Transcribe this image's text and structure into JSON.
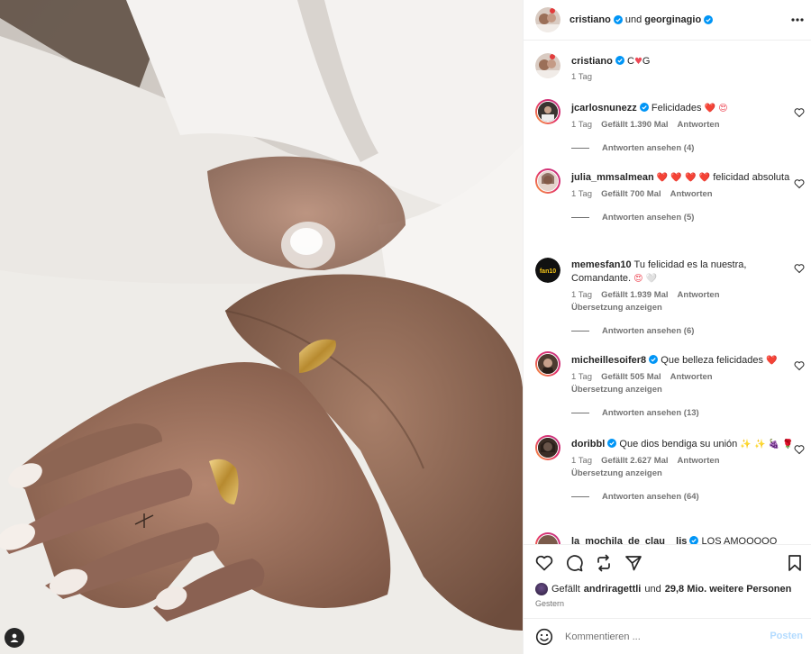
{
  "header": {
    "user1": "cristiano",
    "connector": "und",
    "user2": "georginagio"
  },
  "caption": {
    "username": "cristiano",
    "text_before": "C",
    "text_after": "G",
    "time": "1 Tag"
  },
  "comments": [
    {
      "username": "jcarlosnunezz",
      "text": "Felicidades",
      "emojis": "❤️ 😍",
      "time": "1 Tag",
      "likes": "Gefällt 1.390 Mal",
      "reply_label": "Antworten",
      "view_replies": "Antworten ansehen (4)"
    },
    {
      "username": "julia_mmsalmean",
      "emojis": "❤️ ❤️ ❤️ ❤️",
      "text": "felicidad absoluta",
      "time": "1 Tag",
      "likes": "Gefällt 700 Mal",
      "reply_label": "Antworten",
      "view_replies": "Antworten ansehen (5)"
    },
    {
      "username": "memesfan10",
      "text": "Tu felicidad es la nuestra, Comandante.",
      "emojis": "😍 🤍",
      "time": "1 Tag",
      "likes": "Gefällt 1.939 Mal",
      "reply_label": "Antworten",
      "translate": "Übersetzung anzeigen",
      "view_replies": "Antworten ansehen (6)"
    },
    {
      "username": "micheillesoifer8",
      "text": "Que belleza felicidades",
      "emojis": "❤️",
      "time": "1 Tag",
      "likes": "Gefällt 505 Mal",
      "reply_label": "Antworten",
      "translate": "Übersetzung anzeigen",
      "view_replies": "Antworten ansehen (13)"
    },
    {
      "username": "doribbl",
      "text": "Que dios bendiga su unión",
      "emojis": "✨ ✨ 🍇 🌹",
      "time": "1 Tag",
      "likes": "Gefällt 2.627 Mal",
      "reply_label": "Antworten",
      "translate": "Übersetzung anzeigen",
      "view_replies": "Antworten ansehen (64)"
    },
    {
      "username": "la_mochila_de_clau__lis",
      "text": "LOS AMOOOOO"
    }
  ],
  "likes": {
    "prefix": "Gefällt",
    "user": "andriragettli",
    "middle": "und",
    "count": "29,8 Mio. weitere Personen"
  },
  "date": "Gestern",
  "input": {
    "placeholder": "Kommentieren ...",
    "post_label": "Posten"
  },
  "colors": {
    "verified": "#0095f6",
    "heart": "#ed4956",
    "post_button_disabled": "#b3dbff"
  }
}
